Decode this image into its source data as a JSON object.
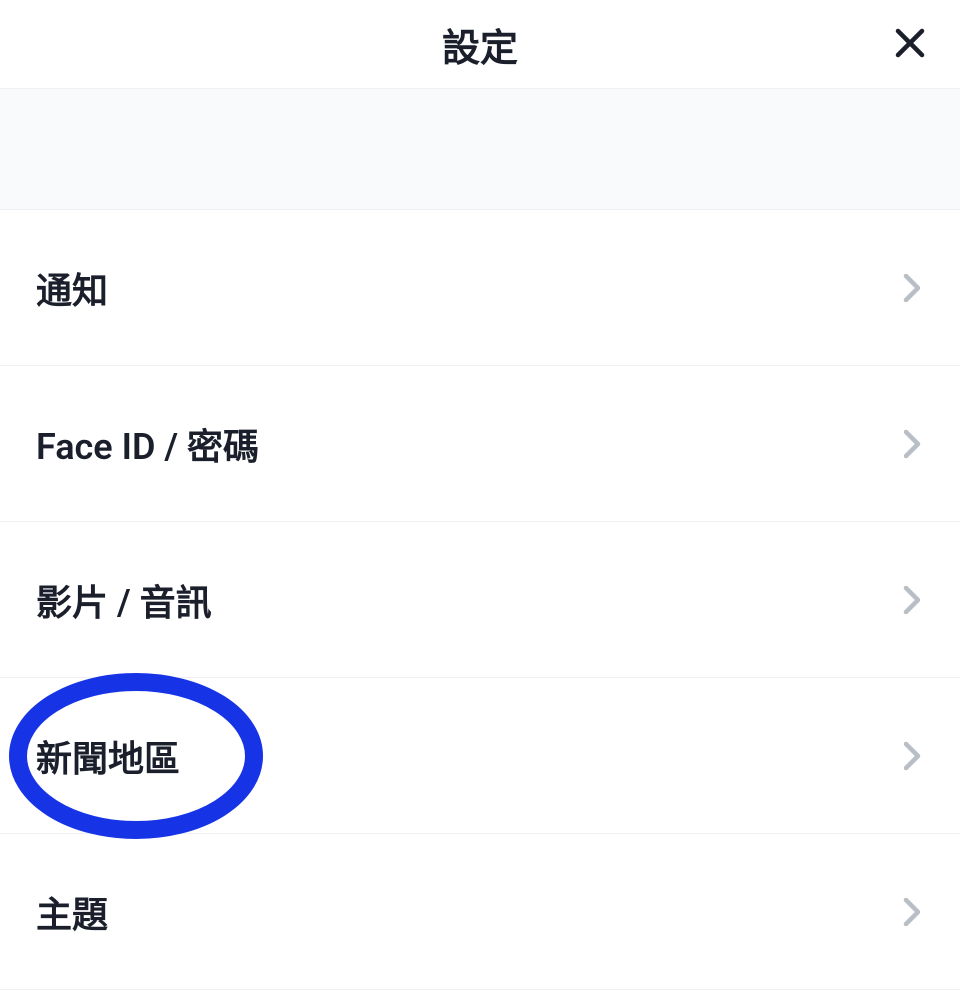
{
  "header": {
    "title": "設定"
  },
  "settings": {
    "items": [
      {
        "label": "通知",
        "highlighted": false
      },
      {
        "label": "Face ID / 密碼",
        "highlighted": false
      },
      {
        "label": "影片 / 音訊",
        "highlighted": false
      },
      {
        "label": "新聞地區",
        "highlighted": true
      },
      {
        "label": "主題",
        "highlighted": false
      }
    ]
  },
  "colors": {
    "highlight": "#1733e6"
  }
}
